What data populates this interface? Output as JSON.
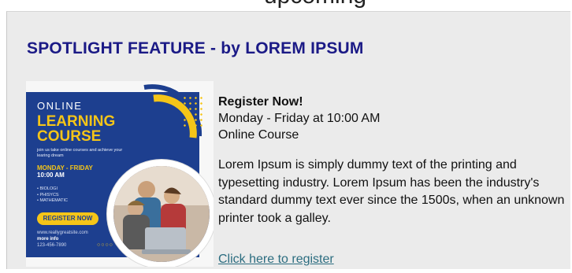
{
  "header": {
    "cut_off_text": "upcoming"
  },
  "spotlight": {
    "title": "SPOTLIGHT FEATURE - by LOREM IPSUM",
    "register_heading": "Register Now!",
    "schedule": "Monday - Friday at 10:00 AM",
    "format": "Online Course",
    "description": "Lorem Ipsum is simply dummy text of the printing and typesetting industry. Lorem Ipsum has been the industry's standard dummy text ever since the 1500s, when an unknown printer took a galley.",
    "link_label": "Click here to register"
  },
  "flyer": {
    "online": "ONLINE",
    "course_line1": "LEARNING",
    "course_line2": "COURSE",
    "tagline": "join us take online courses and achieve your learing dream",
    "days": "MONDAY - FRIDAY",
    "time": "10:00 AM",
    "subjects": [
      "• BIOLOGI",
      "• PHISYCS",
      "• MATHEMATIC"
    ],
    "register_button": "REGISTER NOW",
    "website": "www.reallygreatsite.com",
    "more_info": "more info",
    "phone": "123-456-7890"
  },
  "colors": {
    "title": "#1b1a86",
    "link": "#2c6d80",
    "panel_background": "#ebebeb",
    "flyer_blue": "#1d3f8f",
    "flyer_yellow": "#f5c518"
  }
}
